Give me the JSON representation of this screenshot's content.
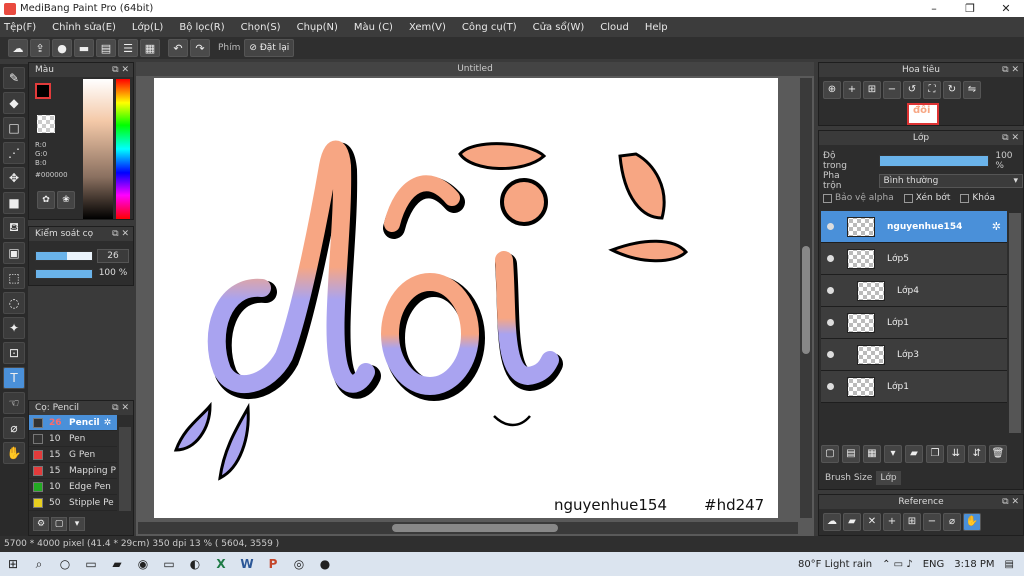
{
  "window": {
    "title": "MediBang Paint Pro (64bit)",
    "controls": [
      "–",
      "❐",
      "✕"
    ]
  },
  "menu": [
    "Tệp(F)",
    "Chỉnh sửa(E)",
    "Lớp(L)",
    "Bộ lọc(R)",
    "Chọn(S)",
    "Chụp(N)",
    "Màu (C)",
    "Xem(V)",
    "Công cụ(T)",
    "Cửa sổ(W)",
    "Cloud",
    "Help"
  ],
  "toolbar": {
    "brush_label": "Phím",
    "reset_label": "Đặt lại"
  },
  "color_panel": {
    "title": "Màu",
    "rgb": [
      "R:0",
      "G:0",
      "B:0"
    ],
    "hex": "#000000"
  },
  "brush_control": {
    "title": "Kiểm soát cọ",
    "size": "26",
    "size_fraction": 0.55,
    "opacity": "100 %",
    "opacity_fraction": 1.0
  },
  "brush_panel": {
    "title": "Cọ: Pencil",
    "items": [
      {
        "size": "26",
        "name": "Pencil",
        "color": "#333333",
        "active": true
      },
      {
        "size": "10",
        "name": "Pen",
        "color": "#333333",
        "active": false
      },
      {
        "size": "15",
        "name": "G Pen",
        "color": "#e33b3b",
        "active": false
      },
      {
        "size": "15",
        "name": "Mapping P",
        "color": "#e33b3b",
        "active": false
      },
      {
        "size": "10",
        "name": "Edge Pen",
        "color": "#22aa22",
        "active": false
      },
      {
        "size": "50",
        "name": "Stipple Pe",
        "color": "#e8d020",
        "active": false
      }
    ]
  },
  "canvas": {
    "tab_title": "Untitled",
    "artwork_text": "đôi",
    "signature": "nguyenhue154",
    "hashtag": "#hd247"
  },
  "navigator": {
    "title": "Hoa tiêu",
    "thumb_text": "đôi"
  },
  "layer_panel": {
    "title": "Lớp",
    "opacity_label": "Độ trong",
    "opacity_value": "100 %",
    "blend_label": "Pha trộn",
    "blend_value": "Bình thường",
    "protect_alpha": "Bảo vệ alpha",
    "clipping": "Xén bớt",
    "lock": "Khóa",
    "layers": [
      {
        "name": "nguyenhue154",
        "active": true,
        "indent": false
      },
      {
        "name": "Lớp5",
        "active": false,
        "indent": false
      },
      {
        "name": "Lớp4",
        "active": false,
        "indent": true
      },
      {
        "name": "Lớp1",
        "active": false,
        "indent": false
      },
      {
        "name": "Lớp3",
        "active": false,
        "indent": true
      },
      {
        "name": "Lớp1",
        "active": false,
        "indent": false
      }
    ],
    "tabs": [
      "Brush Size",
      "Lớp"
    ]
  },
  "reference": {
    "title": "Reference"
  },
  "status": {
    "text": "5700 * 4000 pixel   (41.4 * 29cm)   350 dpi   13 %   ( 5604, 3559 )"
  },
  "taskbar": {
    "weather": "80°F  Light rain",
    "lang": "ENG",
    "time": "3:18 PM"
  }
}
